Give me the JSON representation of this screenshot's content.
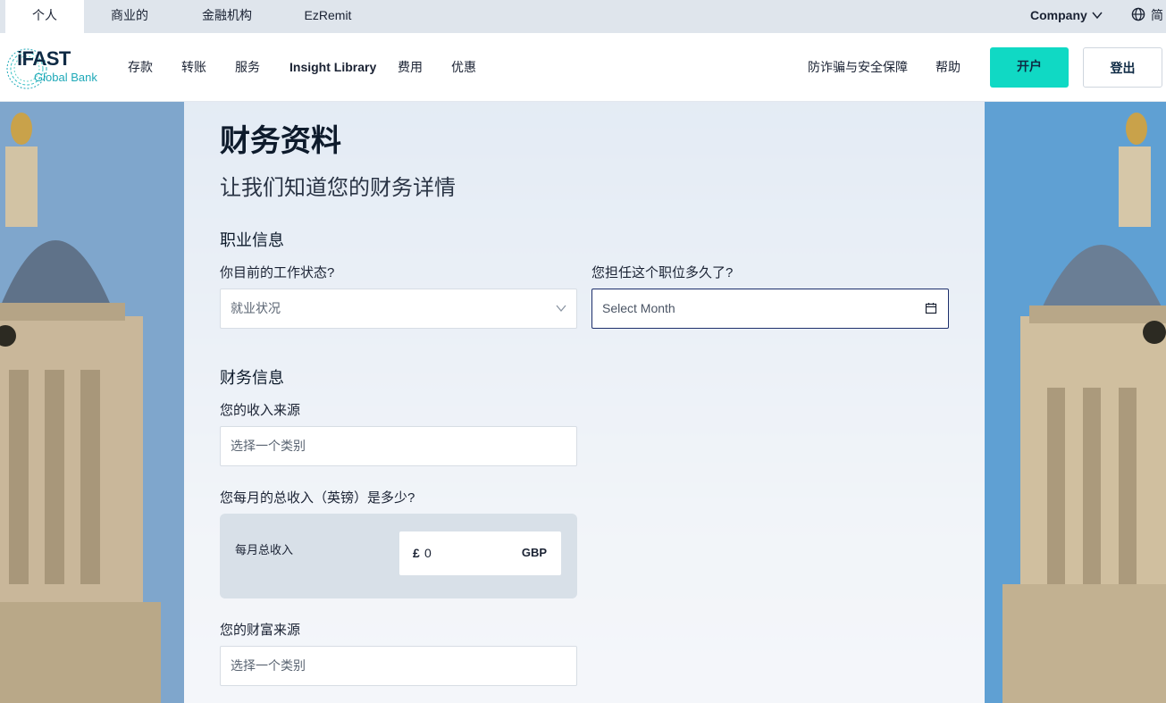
{
  "top_tabs": [
    "个人",
    "商业的",
    "金融机构",
    "EzRemit"
  ],
  "top_right": {
    "company": "Company",
    "lang": "简"
  },
  "logo": {
    "word": "iFAST",
    "sub": "Global Bank"
  },
  "nav": {
    "items": [
      "存款",
      "转账",
      "服务",
      "Insight Library",
      "费用",
      "优惠"
    ],
    "right_items": [
      "防诈骗与安全保障",
      "帮助"
    ],
    "open_account": "开户",
    "logout": "登出"
  },
  "form": {
    "title": "财务资料",
    "subtitle": "让我们知道您的财务详情",
    "employment": {
      "heading": "职业信息",
      "status_label": "你目前的工作状态?",
      "status_placeholder": "就业状况",
      "duration_label": "您担任这个职位多久了?",
      "duration_placeholder": "Select Month"
    },
    "financial": {
      "heading": "财务信息",
      "income_source_label": "您的收入来源",
      "income_source_placeholder": "选择一个类别",
      "monthly_income_label": "您每月的总收入（英镑）是多少?",
      "monthly_income_box_label": "每月总收入",
      "currency_symbol": "£",
      "monthly_income_value": "0",
      "currency": "GBP",
      "wealth_source_label": "您的财富来源",
      "wealth_source_placeholder": "选择一个类别"
    }
  },
  "colors": {
    "accent": "#10d9c4",
    "navy": "#0e2a44",
    "focus_border": "#1d2f6b"
  },
  "icons": [
    "chevron-down-icon",
    "globe-icon",
    "calendar-icon"
  ]
}
